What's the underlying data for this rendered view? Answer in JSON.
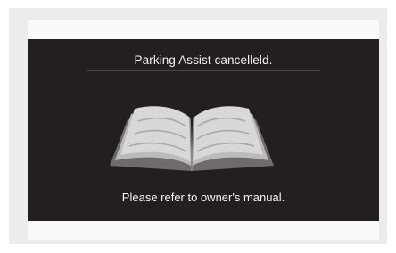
{
  "screen": {
    "title": "Parking Assist cancelleld.",
    "message": "Please refer to owner's manual.",
    "icon": "open-book-icon"
  },
  "colors": {
    "background": "#231f20",
    "text": "#f5f5f5",
    "frame": "#ececec"
  }
}
